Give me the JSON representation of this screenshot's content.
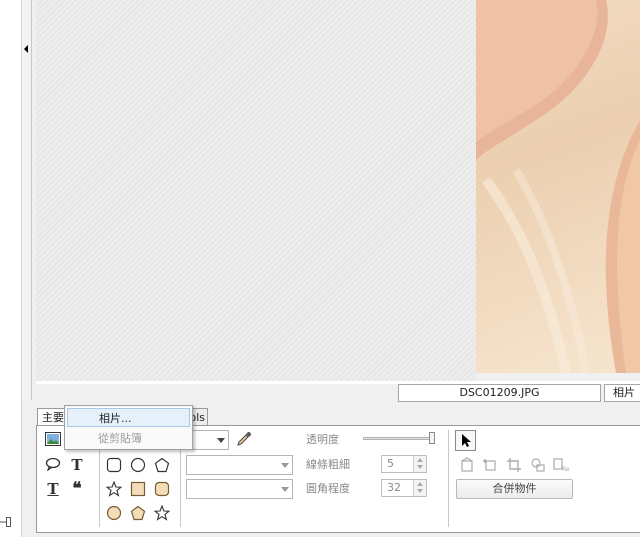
{
  "image_info": {
    "filename": "DSC01209.JPG",
    "label": "相片"
  },
  "tabs": [
    {
      "label": "主要"
    },
    {
      "label": "ols"
    }
  ],
  "popup_menu": {
    "items": [
      {
        "label": "相片...",
        "enabled": true,
        "highlighted": true
      },
      {
        "label": "從剪貼簿",
        "enabled": false,
        "highlighted": false
      }
    ]
  },
  "tools_panel": {
    "opacity_label": "透明度",
    "opacity": 1.0,
    "line_width_label": "線條粗細",
    "line_width_value": "5",
    "corner_label": "圓角程度",
    "corner_value": "32",
    "merge_button_label": "合併物件"
  },
  "colors": {
    "highlight": "#e6f0fa",
    "panel_bg": "#ffffff",
    "canvas_bg": "#e8e8e8"
  }
}
